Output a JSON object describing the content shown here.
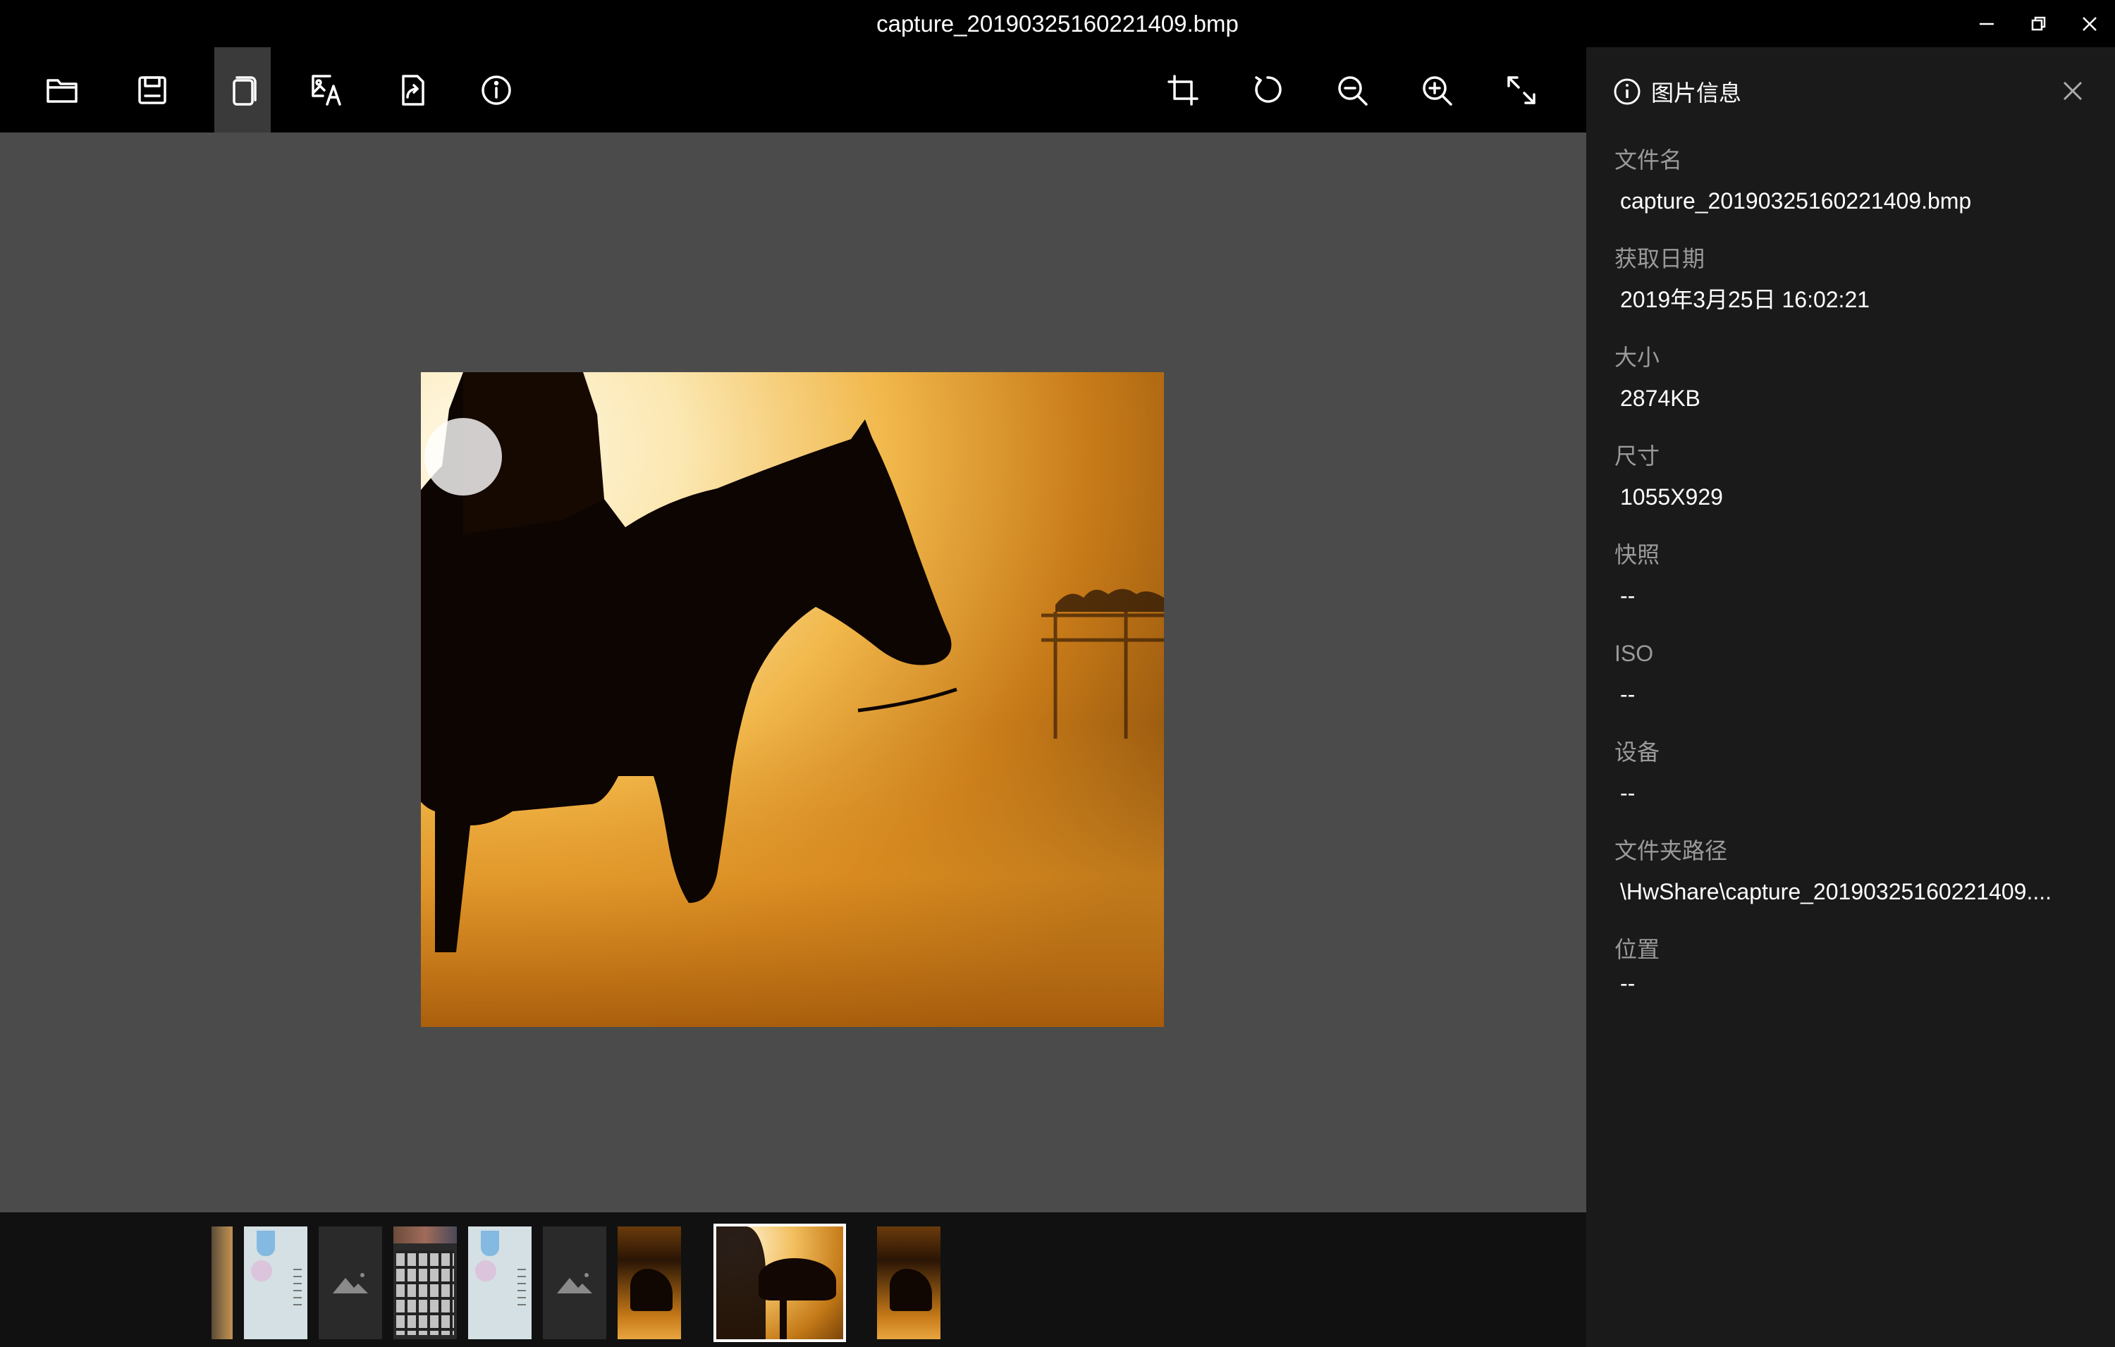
{
  "window": {
    "title": "capture_20190325160221409.bmp"
  },
  "toolbar": {
    "left_icons": [
      "folder-open-icon",
      "save-icon",
      "copy-icon",
      "image-text-icon",
      "share-icon",
      "info-icon"
    ],
    "right_icons": [
      "crop-icon",
      "rotate-icon",
      "zoom-out-icon",
      "zoom-in-icon",
      "fullscreen-icon"
    ]
  },
  "info_panel": {
    "title": "图片信息",
    "fields": [
      {
        "label": "文件名",
        "value": "capture_20190325160221409.bmp"
      },
      {
        "label": "获取日期",
        "value": "2019年3月25日 16:02:21"
      },
      {
        "label": "大小",
        "value": "2874KB"
      },
      {
        "label": "尺寸",
        "value": "1055X929"
      },
      {
        "label": "快照",
        "value": "--"
      },
      {
        "label": "ISO",
        "value": "--"
      },
      {
        "label": "设备",
        "value": "--"
      },
      {
        "label": "文件夹路径",
        "value": "\\HwShare\\capture_20190325160221409...."
      },
      {
        "label": "位置",
        "value": "--"
      }
    ]
  },
  "filmstrip": {
    "thumbnails": [
      "partial-photo",
      "phone-screenshot",
      "image-placeholder",
      "keyboard-photo",
      "phone-screenshot",
      "image-placeholder",
      "horse-sunset",
      "horse-sunset-selected",
      "horse-sunset"
    ]
  },
  "colors": {
    "viewer_bg": "#4b4b4b",
    "panel_bg": "#1a1a1a",
    "toolbar_bg": "#000000",
    "accent_selected": "#3a3a3a"
  }
}
